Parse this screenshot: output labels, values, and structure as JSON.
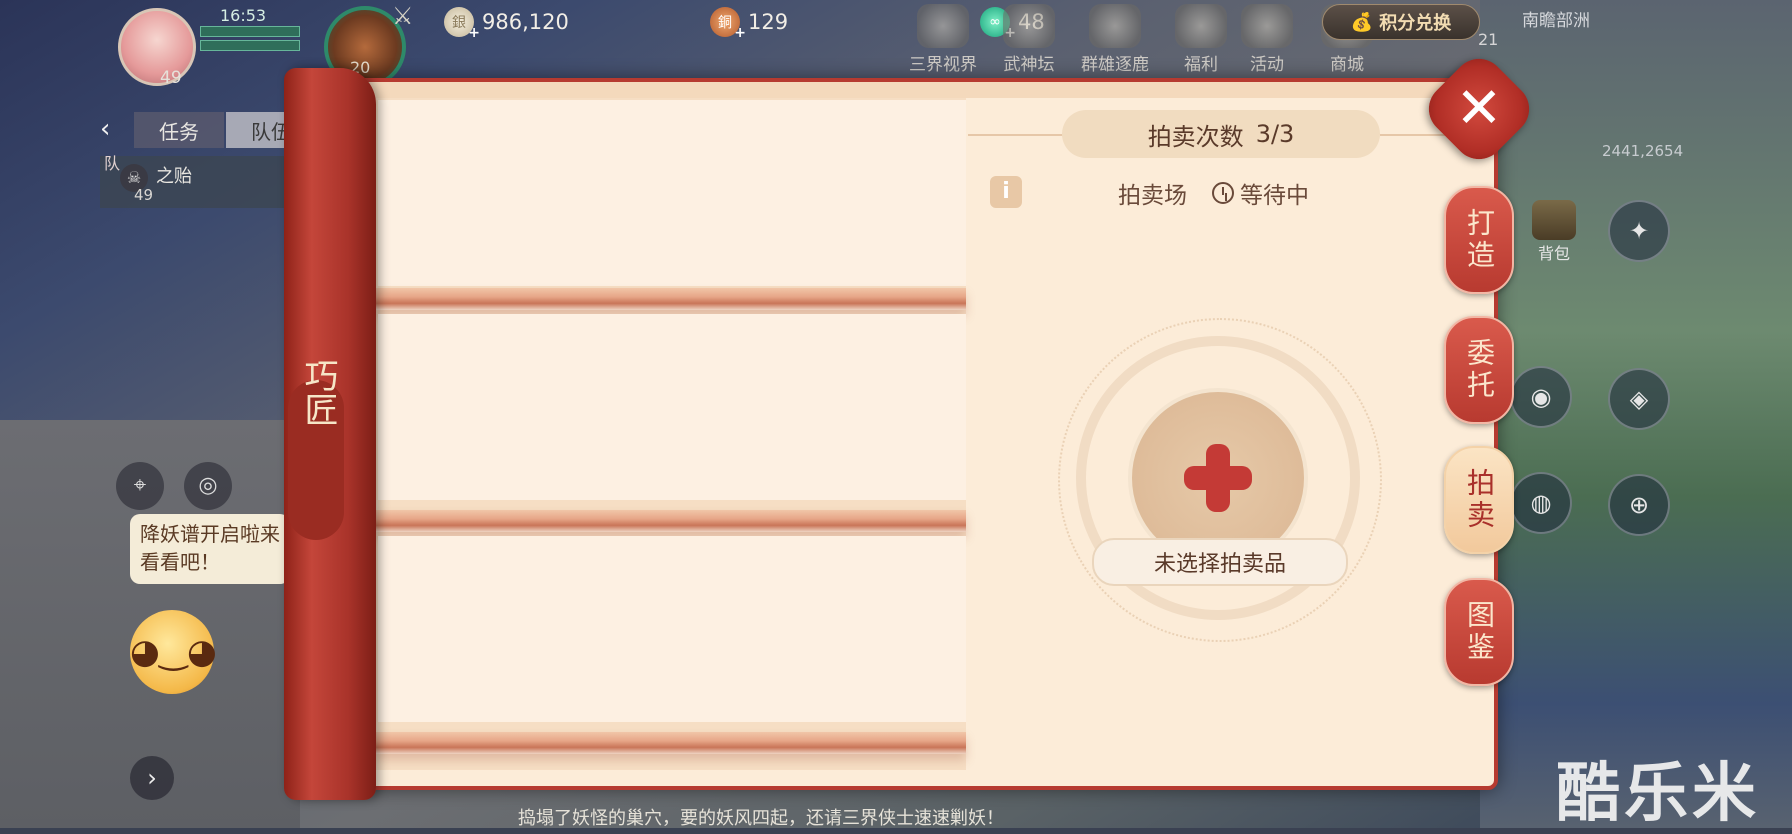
{
  "hud": {
    "time": "16:53",
    "player_level": "49",
    "pet_level": "20",
    "silver": "986,120",
    "copper": "129",
    "jade": "48",
    "exchange_label": "积分兑换",
    "region": "南瞻部洲",
    "coords": "2441,2654",
    "mini_number": "21"
  },
  "top_menu": [
    "三界视界",
    "武神坛",
    "群雄逐鹿",
    "福利",
    "活动",
    "商城"
  ],
  "left": {
    "tabs": [
      "任务",
      "队伍"
    ],
    "team_mark": "队",
    "member_name": "之贻",
    "member_level": "49",
    "bubble_text": "降妖谱开启啦来看看吧！",
    "chat_text": "捣塌了妖怪的巢穴，要的妖风四起，还请三界侠士速速剿妖！"
  },
  "panel": {
    "scroll_label": "巧匠",
    "auction_count_label": "拍卖次数",
    "auction_count_value": "3/3",
    "auction_house": "拍卖场",
    "status": "等待中",
    "item_label": "未选择拍卖品",
    "side_tabs": [
      "打造",
      "委托",
      "拍卖",
      "图鉴"
    ],
    "active_tab": "拍卖"
  },
  "right": {
    "bag_label": "背包"
  },
  "watermark": "酷乐米"
}
